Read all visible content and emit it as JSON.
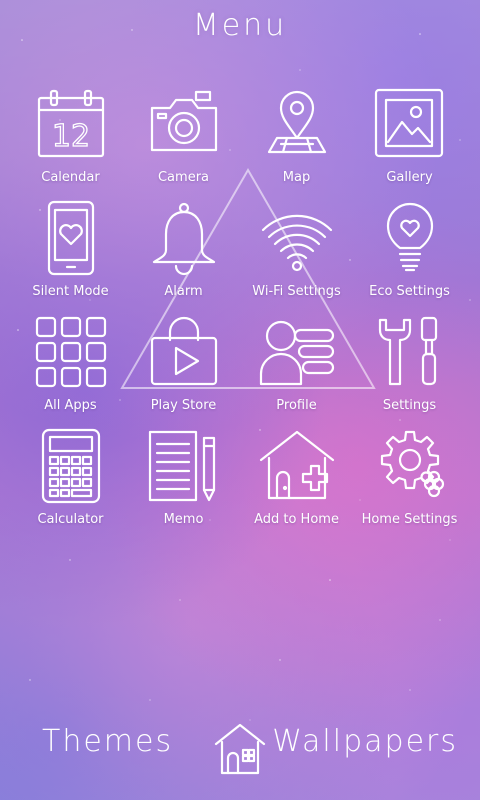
{
  "header": {
    "title": "Menu"
  },
  "apps": [
    {
      "label": "Calendar",
      "icon": "calendar-icon",
      "calendar_day": "12"
    },
    {
      "label": "Camera",
      "icon": "camera-icon"
    },
    {
      "label": "Map",
      "icon": "map-pin-icon"
    },
    {
      "label": "Gallery",
      "icon": "gallery-icon"
    },
    {
      "label": "Silent Mode",
      "icon": "phone-heart-icon"
    },
    {
      "label": "Alarm",
      "icon": "bell-icon"
    },
    {
      "label": "Wi-Fi Settings",
      "icon": "wifi-icon"
    },
    {
      "label": "Eco Settings",
      "icon": "lightbulb-heart-icon"
    },
    {
      "label": "All Apps",
      "icon": "grid-icon"
    },
    {
      "label": "Play Store",
      "icon": "shopping-bag-play-icon"
    },
    {
      "label": "Profile",
      "icon": "profile-card-icon"
    },
    {
      "label": "Settings",
      "icon": "wrench-screwdriver-icon"
    },
    {
      "label": "Calculator",
      "icon": "calculator-icon"
    },
    {
      "label": "Memo",
      "icon": "notepad-pencil-icon"
    },
    {
      "label": "Add to Home",
      "icon": "house-plus-icon"
    },
    {
      "label": "Home Settings",
      "icon": "gear-flower-icon"
    }
  ],
  "bottom": {
    "themes_label": "Themes",
    "wallpapers_label": "Wallpapers",
    "home_icon": "house-icon"
  },
  "colors": {
    "icon_stroke": "#ffffff",
    "background_top": "#a58fd9",
    "background_mid": "#bb7ad0"
  }
}
